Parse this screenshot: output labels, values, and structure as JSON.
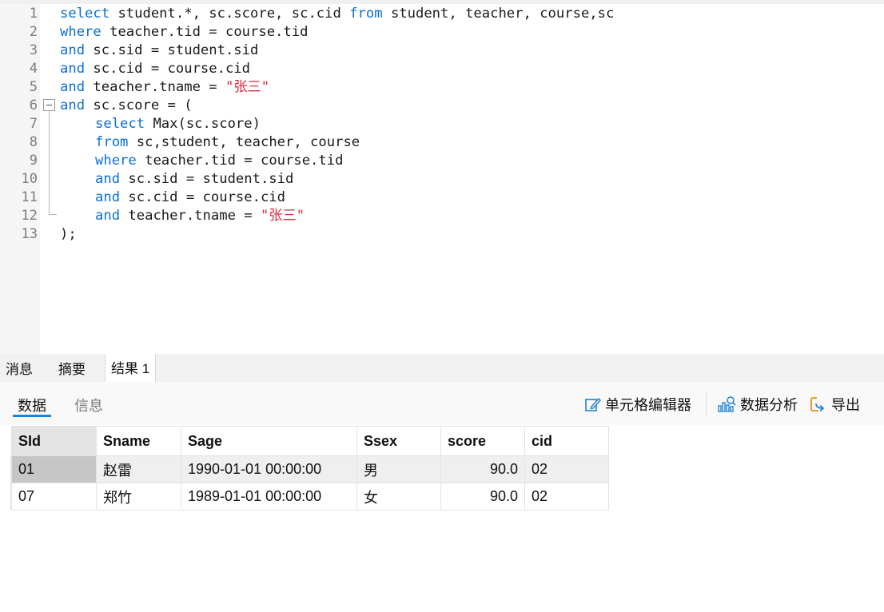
{
  "editor": {
    "line_numbers": [
      "1",
      "2",
      "3",
      "4",
      "5",
      "6",
      "7",
      "8",
      "9",
      "10",
      "11",
      "12",
      "13"
    ],
    "lines": [
      {
        "tokens": [
          {
            "t": "select",
            "k": "kw"
          },
          {
            "t": " student.*, sc.score, sc.cid "
          },
          {
            "t": "from",
            "k": "kw"
          },
          {
            "t": " student, teacher, course,sc"
          }
        ]
      },
      {
        "tokens": [
          {
            "t": "where",
            "k": "kw"
          },
          {
            "t": " teacher.tid = course.tid"
          }
        ]
      },
      {
        "tokens": [
          {
            "t": "and",
            "k": "kw"
          },
          {
            "t": " sc.sid = student.sid"
          }
        ]
      },
      {
        "tokens": [
          {
            "t": "and",
            "k": "kw"
          },
          {
            "t": " sc.cid = course.cid"
          }
        ]
      },
      {
        "tokens": [
          {
            "t": "and",
            "k": "kw"
          },
          {
            "t": " teacher.tname = "
          },
          {
            "t": "\"张三\"",
            "k": "str"
          }
        ]
      },
      {
        "tokens": [
          {
            "t": "and",
            "k": "kw"
          },
          {
            "t": " sc.score = ("
          }
        ]
      },
      {
        "indent": true,
        "tokens": [
          {
            "t": "select",
            "k": "kw"
          },
          {
            "t": " Max(sc.score)"
          }
        ]
      },
      {
        "indent": true,
        "tokens": [
          {
            "t": "from",
            "k": "kw"
          },
          {
            "t": " sc,student, teacher, course"
          }
        ]
      },
      {
        "indent": true,
        "tokens": [
          {
            "t": "where",
            "k": "kw"
          },
          {
            "t": " teacher.tid = course.tid"
          }
        ]
      },
      {
        "indent": true,
        "tokens": [
          {
            "t": "and",
            "k": "kw"
          },
          {
            "t": " sc.sid = student.sid"
          }
        ]
      },
      {
        "indent": true,
        "tokens": [
          {
            "t": "and",
            "k": "kw"
          },
          {
            "t": " sc.cid = course.cid"
          }
        ]
      },
      {
        "indent": true,
        "tokens": [
          {
            "t": "and",
            "k": "kw"
          },
          {
            "t": " teacher.tname = "
          },
          {
            "t": "\"张三\"",
            "k": "str"
          }
        ]
      },
      {
        "tokens": [
          {
            "t": ");"
          }
        ]
      }
    ]
  },
  "panel_tabs": [
    "消息",
    "摘要",
    "结果 1"
  ],
  "active_panel_tab": "结果 1",
  "sub_tabs": {
    "data": "数据",
    "info": "信息"
  },
  "toolbar": {
    "cell_editor": "单元格编辑器",
    "data_analysis": "数据分析",
    "export": "导出"
  },
  "grid": {
    "columns": [
      "SId",
      "Sname",
      "Sage",
      "Ssex",
      "score",
      "cid"
    ],
    "rows": [
      [
        "01",
        "赵雷",
        "1990-01-01 00:00:00",
        "男",
        "90.0",
        "02"
      ],
      [
        "07",
        "郑竹",
        "1989-01-01 00:00:00",
        "女",
        "90.0",
        "02"
      ]
    ]
  },
  "colors": {
    "keyword": "#0a6fd4",
    "string": "#d92b3f",
    "accent": "#1f84d4"
  }
}
